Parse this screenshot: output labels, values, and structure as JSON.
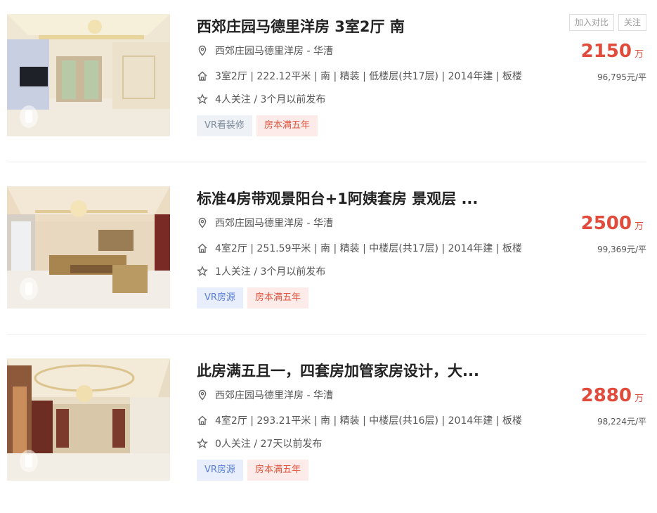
{
  "listings": [
    {
      "title": "西郊庄园马德里洋房 3室2厅 南",
      "location": "西郊庄园马德里洋房 - 华漕",
      "house_info": "3室2厅 | 222.12平米 | 南 | 精装 | 低楼层(共17层) | 2014年建 | 板楼",
      "follow_info": "4人关注 / 3个月以前发布",
      "tags": [
        {
          "label": "VR看装修",
          "kind": "vr-decor"
        },
        {
          "label": "房本满五年",
          "kind": "five"
        }
      ],
      "price": "2150",
      "price_unit": "万",
      "unit_price": "96,795元/平",
      "show_actions": true
    },
    {
      "title": "标准4房带观景阳台+1阿姨套房 景观层 ...",
      "location": "西郊庄园马德里洋房 - 华漕",
      "house_info": "4室2厅 | 251.59平米 | 南 | 精装 | 中楼层(共17层) | 2014年建 | 板楼",
      "follow_info": "1人关注 / 3个月以前发布",
      "tags": [
        {
          "label": "VR房源",
          "kind": "vr"
        },
        {
          "label": "房本满五年",
          "kind": "five"
        }
      ],
      "price": "2500",
      "price_unit": "万",
      "unit_price": "99,369元/平",
      "show_actions": false
    },
    {
      "title": "此房满五且一，四套房加管家房设计，大...",
      "location": "西郊庄园马德里洋房 - 华漕",
      "house_info": "4室2厅 | 293.21平米 | 南 | 精装 | 中楼层(共16层) | 2014年建 | 板楼",
      "follow_info": "0人关注 / 27天以前发布",
      "tags": [
        {
          "label": "VR房源",
          "kind": "vr"
        },
        {
          "label": "房本满五年",
          "kind": "five"
        }
      ],
      "price": "2880",
      "price_unit": "万",
      "unit_price": "98,224元/平",
      "show_actions": false
    }
  ],
  "actions": {
    "compare_label": "加入对比",
    "follow_label": "关注"
  },
  "icons": {
    "location": "location-pin-icon",
    "house": "house-icon",
    "follow": "star-icon"
  },
  "colors": {
    "price": "#e14b3b",
    "vr_tag": "#5b7fd6",
    "five_year_tag": "#e0553f"
  }
}
